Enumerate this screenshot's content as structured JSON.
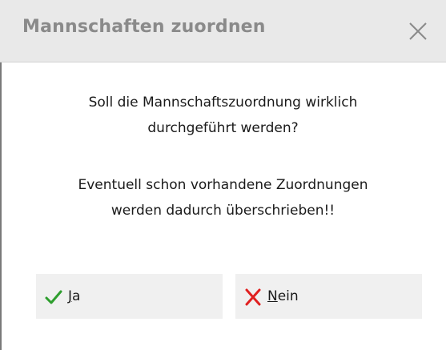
{
  "dialog": {
    "title": "Mannschaften zuordnen",
    "close_icon": "close-icon",
    "message_line1": "Soll die Mannschaftszuordnung wirklich",
    "message_line2": "durchgeführt werden?",
    "message_line3": "Eventuell schon vorhandene Zuordnungen",
    "message_line4": "werden dadurch überschrieben!!"
  },
  "buttons": {
    "yes": {
      "mnemonic": "J",
      "rest": "a",
      "icon": "checkmark-icon",
      "icon_color": "#2e9e2e"
    },
    "no": {
      "mnemonic": "N",
      "rest": "ein",
      "icon": "cross-icon",
      "icon_color": "#e02020"
    }
  },
  "colors": {
    "titlebar_bg": "#e9e9e9",
    "title_text": "#8a8a8a",
    "button_bg": "#f0f0f0"
  }
}
